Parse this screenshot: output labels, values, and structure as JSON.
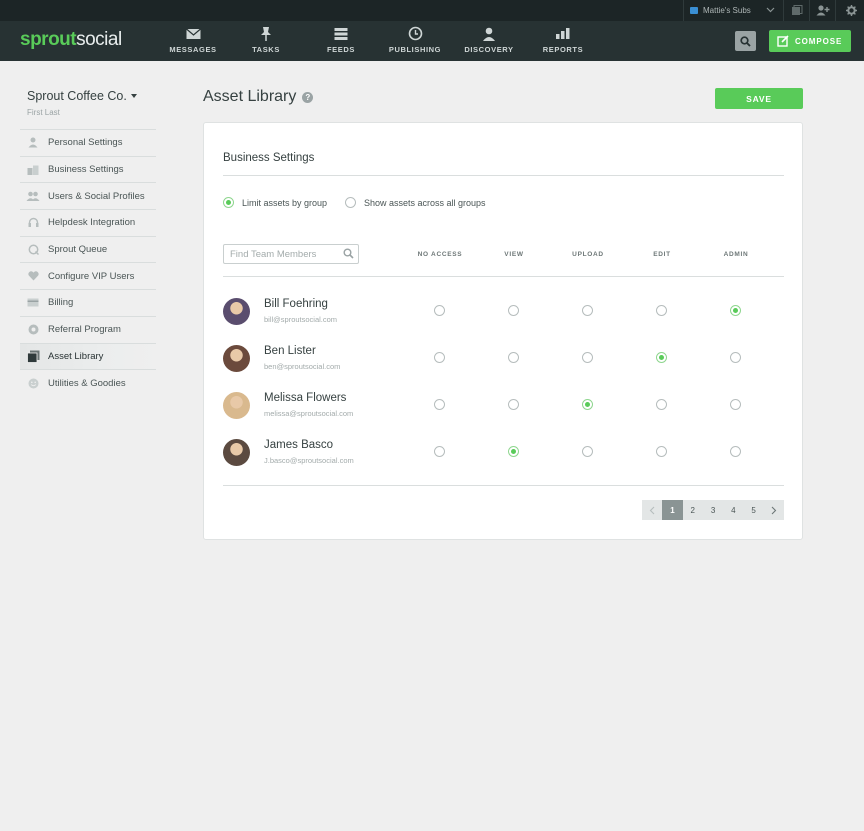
{
  "topbar": {
    "account_name": "Mattie's Subs"
  },
  "nav": {
    "logo_part1": "sprout",
    "logo_part2": "social",
    "items": [
      {
        "label": "MESSAGES",
        "icon": "envelope-icon"
      },
      {
        "label": "TASKS",
        "icon": "pin-icon"
      },
      {
        "label": "FEEDS",
        "icon": "feeds-icon"
      },
      {
        "label": "PUBLISHING",
        "icon": "clock-icon"
      },
      {
        "label": "DISCOVERY",
        "icon": "person-icon"
      },
      {
        "label": "REPORTS",
        "icon": "bar-chart-icon"
      }
    ],
    "compose_label": "COMPOSE"
  },
  "sidebar": {
    "brand": "Sprout Coffee Co.",
    "user": "First Last",
    "items": [
      {
        "label": "Personal Settings",
        "icon": "person-icon"
      },
      {
        "label": "Business Settings",
        "icon": "building-icon"
      },
      {
        "label": "Users & Social Profiles",
        "icon": "users-icon"
      },
      {
        "label": "Helpdesk Integration",
        "icon": "headset-icon"
      },
      {
        "label": "Sprout Queue",
        "icon": "queue-icon"
      },
      {
        "label": "Configure VIP Users",
        "icon": "heart-icon"
      },
      {
        "label": "Billing",
        "icon": "card-icon"
      },
      {
        "label": "Referral Program",
        "icon": "referral-icon"
      },
      {
        "label": "Asset Library",
        "icon": "library-icon"
      },
      {
        "label": "Utilities & Goodies",
        "icon": "smiley-icon"
      }
    ],
    "active_index": 8
  },
  "page": {
    "title": "Asset Library",
    "help": "?",
    "save_label": "SAVE"
  },
  "card": {
    "section_title": "Business Settings",
    "scope_options": [
      {
        "label": "Limit assets by group",
        "selected": true
      },
      {
        "label": "Show assets across all groups",
        "selected": false
      }
    ],
    "search_placeholder": "Find Team Members",
    "columns": [
      "NO ACCESS",
      "VIEW",
      "UPLOAD",
      "EDIT",
      "ADMIN"
    ],
    "members": [
      {
        "name": "Bill Foehring",
        "email": "bill@sproutsocial.com",
        "permission": "ADMIN",
        "avatar_color": "#5a4d6e"
      },
      {
        "name": "Ben Lister",
        "email": "ben@sproutsocial.com",
        "permission": "EDIT",
        "avatar_color": "#6b4a3c"
      },
      {
        "name": "Melissa Flowers",
        "email": "melissa@sproutsocial.com",
        "permission": "UPLOAD",
        "avatar_color": "#d9b98e"
      },
      {
        "name": "James Basco",
        "email": "J.basco@sproutsocial.com",
        "permission": "VIEW",
        "avatar_color": "#5b4a40"
      }
    ],
    "pagination": {
      "pages": [
        "1",
        "2",
        "3",
        "4",
        "5"
      ],
      "current": "1"
    }
  },
  "colors": {
    "accent": "#59cb59",
    "nav_bg": "#273233",
    "topbar_bg": "#1c2526"
  }
}
